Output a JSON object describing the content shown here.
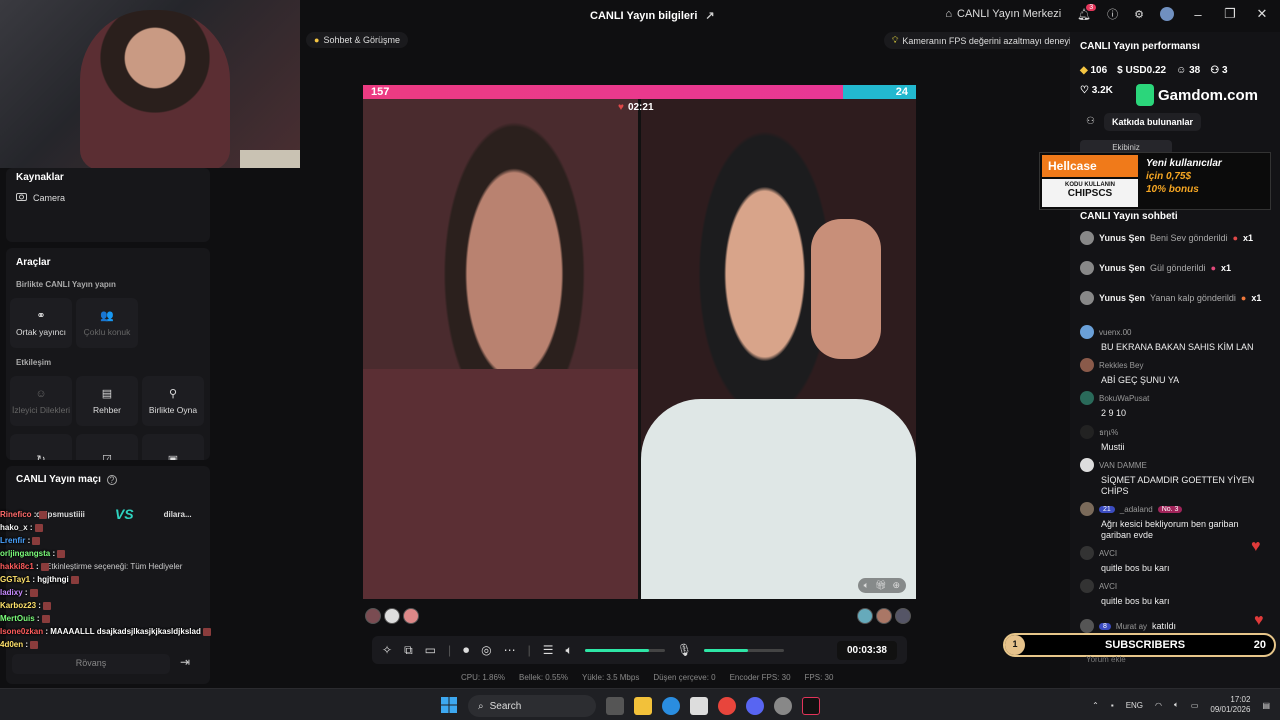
{
  "titlebar": {
    "title": "CANLI Yayın bilgileri",
    "live_center": "CANLI Yayın Merkezi",
    "notif_count": "3"
  },
  "chips": {
    "chat": "Sohbet & Görüşme",
    "fps_tip": "Kameranın FPS değerini azaltmayı deneyin"
  },
  "left": {
    "sources_title": "Kaynaklar",
    "camera": "Camera",
    "tools_title": "Araçlar",
    "go_live_together": "Birlikte CANLI Yayın yapın",
    "co_host": "Ortak yayıncı",
    "multi_guest": "Çoklu konuk",
    "interaction": "Etkileşim",
    "viewer_requests": "İzleyici Dilekleri",
    "guide": "Rehber",
    "play_together": "Birlikte Oyna",
    "match_title": "CANLI Yayın maçı",
    "player1": "chipsmustiiii",
    "player2": "dilara...",
    "rematch": "Rövanş",
    "filter_text": "Etkinleştirme seçeneği: Tüm Hediyeler"
  },
  "chat_overlay": [
    {
      "user": "Rinefico",
      "text": ":",
      "color": "#ff6b6b"
    },
    {
      "user": "hako_x",
      "text": ":",
      "color": "#f2f2f2"
    },
    {
      "user": "Lrenfir",
      "text": ":",
      "color": "#4aa3ff"
    },
    {
      "user": "orljingangsta",
      "text": ":",
      "color": "#7cff7c"
    },
    {
      "user": "hakki8c1",
      "text": ":",
      "color": "#ff5c5c"
    },
    {
      "user": "GGTay1",
      "text": ": hgjthngi",
      "color": "#ffe26b"
    },
    {
      "user": "ladixy",
      "text": ":",
      "color": "#c78bff"
    },
    {
      "user": "Karboz23",
      "text": ":",
      "color": "#ffe26b"
    },
    {
      "user": "MertOuis",
      "text": ":",
      "color": "#7cff7c"
    },
    {
      "user": "Isone0zkan",
      "text": ": MAAAALLL dsajkadsjlkasjkjkasldjkslad",
      "color": "#ff5c5c"
    },
    {
      "user": "4d0en",
      "text": ":",
      "color": "#ffe26b"
    }
  ],
  "stream": {
    "score_left": "157",
    "score_right": "24",
    "timer": "02:21"
  },
  "controls": {
    "rec_time": "00:03:38",
    "mic_level": 0.55,
    "vol_level": 0.8
  },
  "stats": {
    "cpu": "CPU: 1.86%",
    "memory": "Bellek: 0.55%",
    "upload": "Yükle: 3.5 Mbps",
    "dropped": "Düşen çerçeve: 0",
    "encoder_fps": "Encoder FPS: 30",
    "fps": "FPS: 30"
  },
  "right": {
    "perf_title": "CANLI Yayın performansı",
    "diamonds": "106",
    "usd": "USD0.22",
    "viewers": "38",
    "users": "3",
    "likes": "3.2K",
    "gamdom": "Gamdom.com",
    "contributors": "Katkıda bulunanlar",
    "team_tab": "Ekibiniz",
    "chat_title": "CANLI Yayın sohbeti",
    "hellcase": {
      "brand": "Hellcase",
      "code_label": "KODU KULLANIN",
      "code": "CHIPSCS",
      "line1": "Yeni kullanıcılar",
      "line2": "için 0,75$",
      "line3": "10% bonus"
    },
    "gifts": [
      {
        "user": "Yunus Şen",
        "msg": "Beni Sev gönderildi",
        "count": "x1",
        "gift_color": "#e04848"
      },
      {
        "user": "Yunus Şen",
        "msg": "Gül gönderildi",
        "count": "x1",
        "gift_color": "#e0487a"
      },
      {
        "user": "Yunus Şen",
        "msg": "Yanan kalp gönderildi",
        "count": "x1",
        "gift_color": "#f0783a"
      }
    ],
    "messages": [
      {
        "user": "vuenx.00",
        "text": "BU EKRANA BAKAN SAHIS KİM LAN",
        "av": "#6aa0d8"
      },
      {
        "user": "Rekkles Bey",
        "text": "ABİ GEÇ ŞUNU YA",
        "av": "#8a5a4a"
      },
      {
        "user": "BokuWaPusat",
        "text": "2 9 10",
        "av": "#2a6a5a"
      },
      {
        "user": "ธηเ%",
        "text": "Mustii",
        "av": "#222"
      },
      {
        "user": "VAN DAMME",
        "text": "SİQMET ADAMDIR GOETTEN YİYEN CHİPS",
        "av": "#ddd"
      },
      {
        "user": "_adaland",
        "text": "Ağrı kesici bekliyorum ben gariban gariban evde",
        "av": "#7a6a5a",
        "level": "21",
        "badge": "No. 3"
      },
      {
        "user": "AVCI",
        "text": "quitle bos bu karı",
        "av": "#333"
      },
      {
        "user": "AVCI",
        "text": "quitle bos bu karı",
        "av": "#333"
      },
      {
        "user": "Murat ay",
        "text": "katıldı",
        "av": "#555",
        "level": "8"
      }
    ],
    "subs_count_left": "1",
    "subs_label": "SUBSCRIBERS",
    "subs_count_right": "20",
    "comment_placeholder": "Yorum ekle"
  },
  "taskbar": {
    "search": "Search",
    "lang": "ENG",
    "time": "17:02",
    "date": "09/01/2026"
  }
}
